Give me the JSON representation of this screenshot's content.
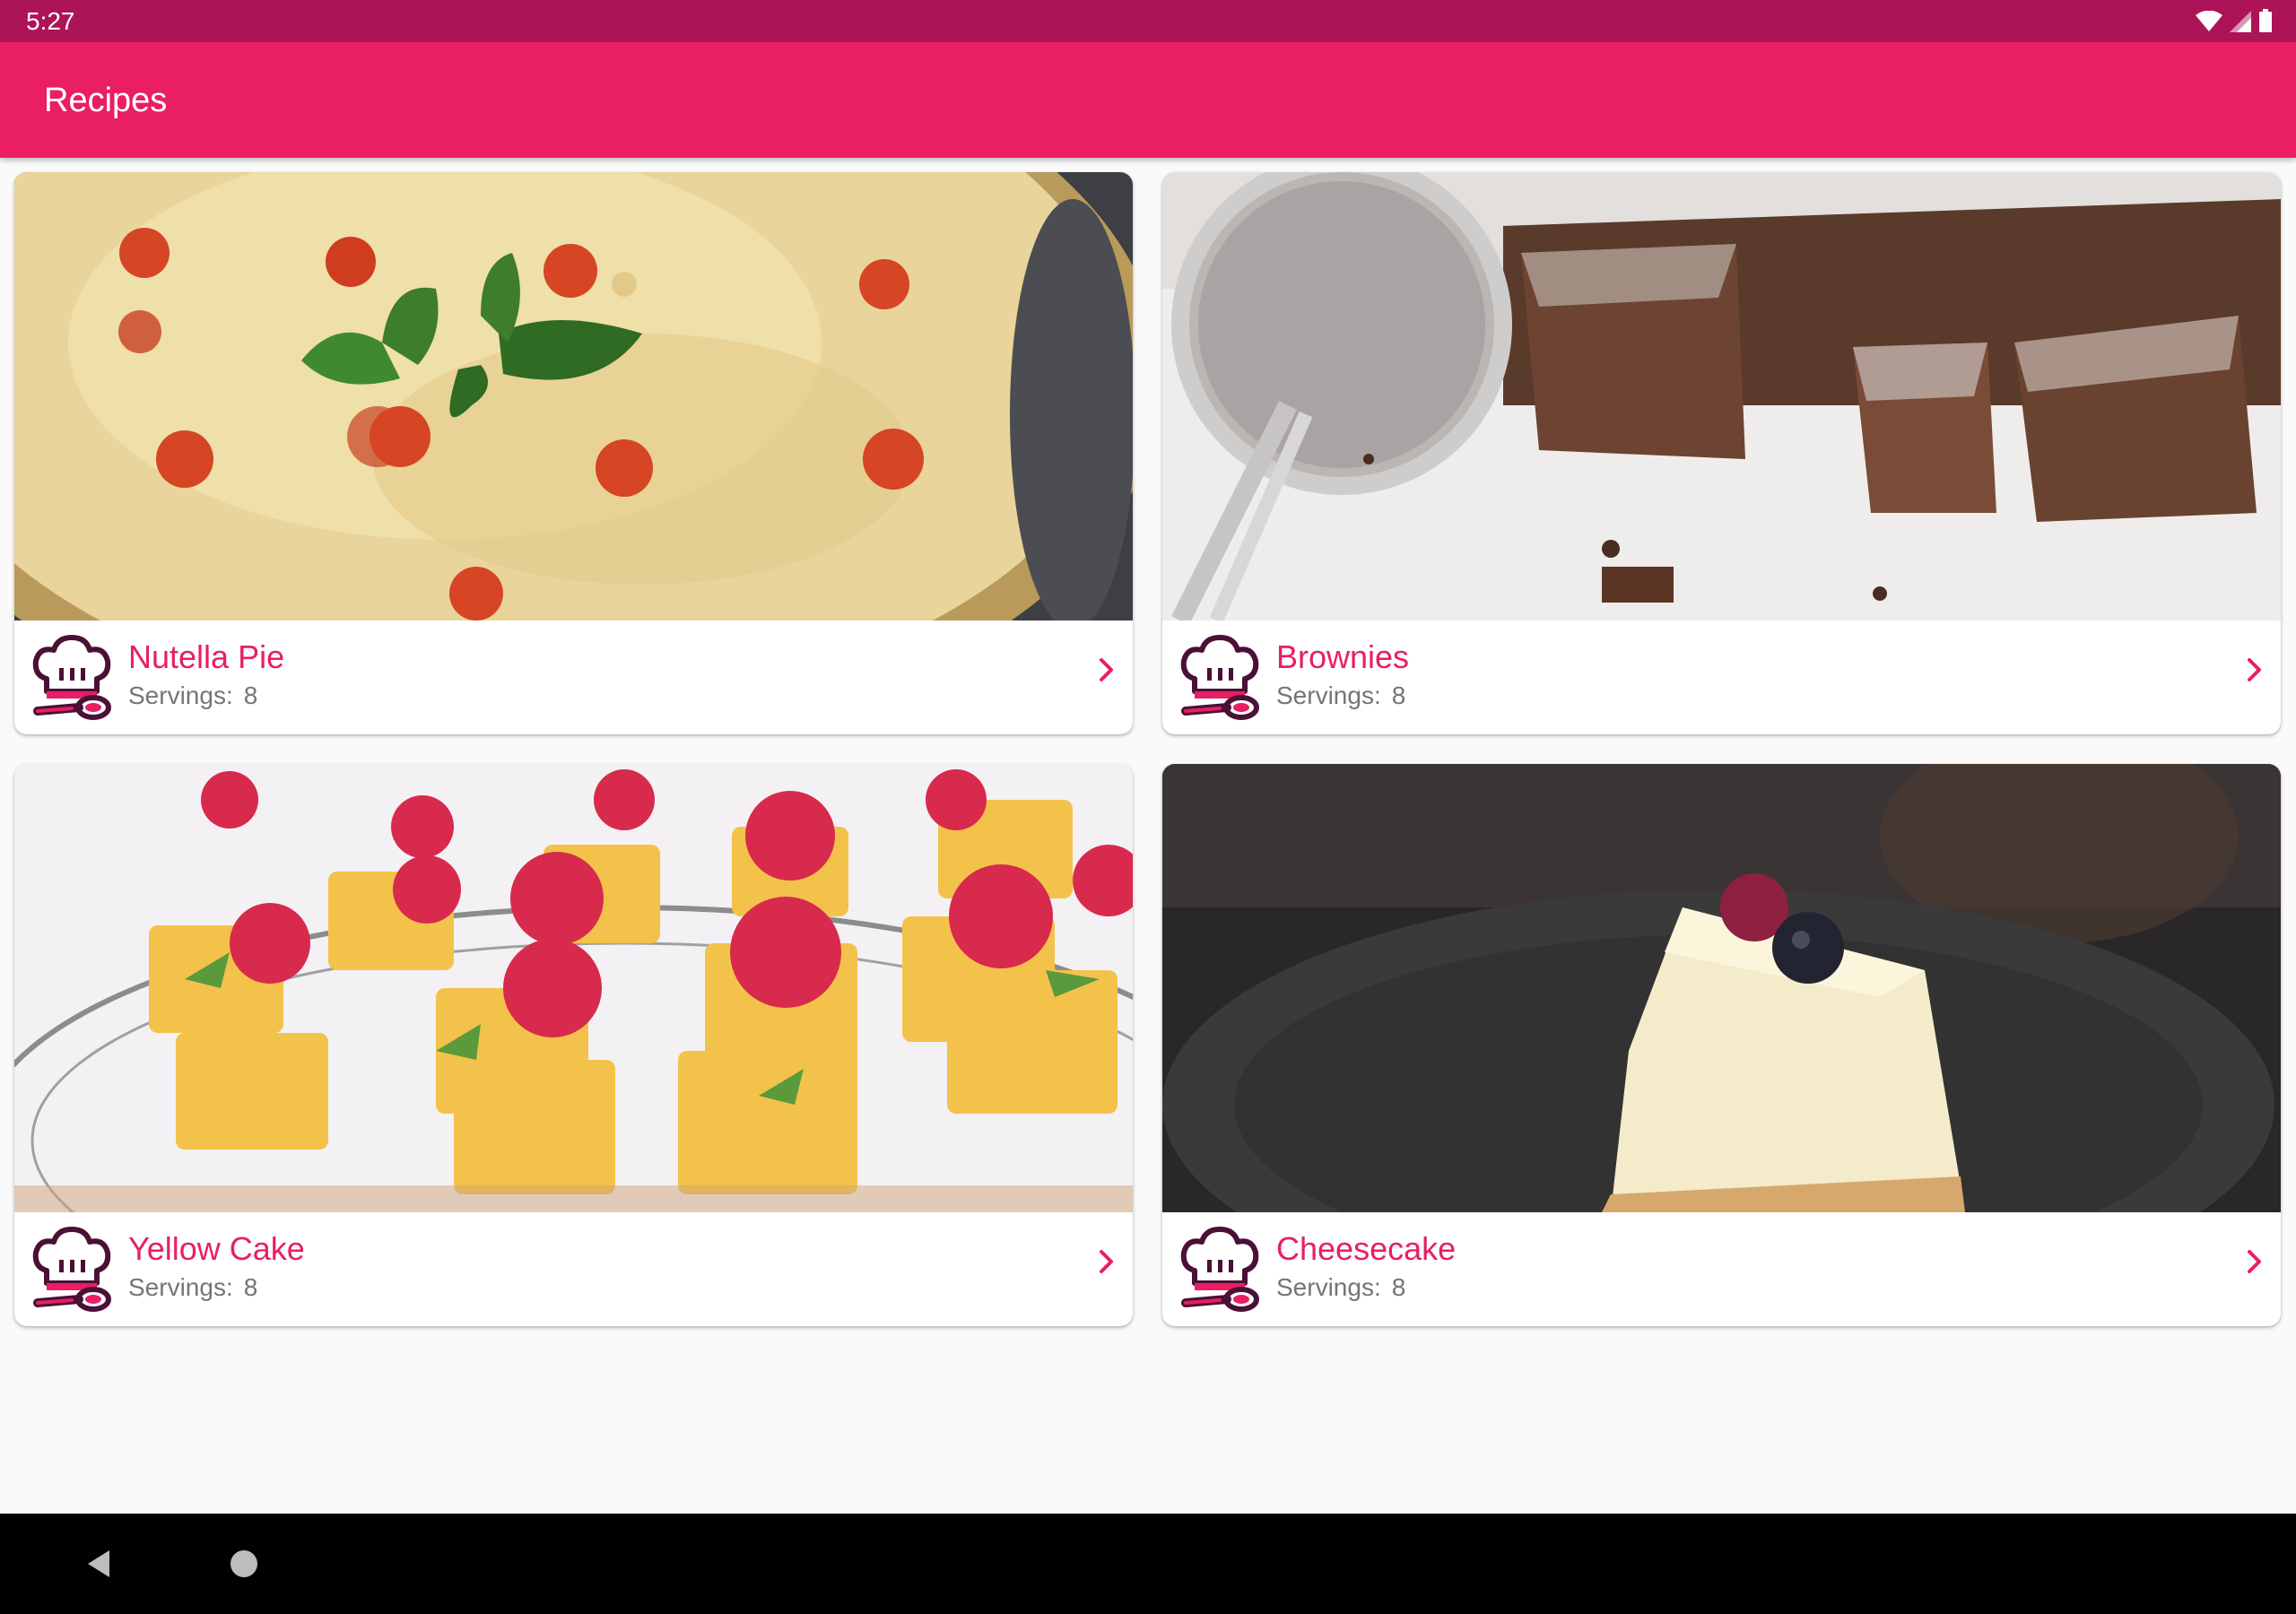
{
  "status_bar": {
    "time": "5:27"
  },
  "app_bar": {
    "title": "Recipes"
  },
  "colors": {
    "primary": "#e91e63",
    "primary_dark": "#ad1457",
    "chef_icon": "#4a1036"
  },
  "recipes": [
    {
      "name": "Nutella Pie",
      "servings_label": "Servings:",
      "servings": "8",
      "icon": "chef-hat-spoon-icon"
    },
    {
      "name": "Brownies",
      "servings_label": "Servings:",
      "servings": "8",
      "icon": "chef-hat-spoon-icon"
    },
    {
      "name": "Yellow Cake",
      "servings_label": "Servings:",
      "servings": "8",
      "icon": "chef-hat-spoon-icon"
    },
    {
      "name": "Cheesecake",
      "servings_label": "Servings:",
      "servings": "8",
      "icon": "chef-hat-spoon-icon"
    }
  ],
  "nav_bar": {
    "icons": [
      "back-icon",
      "home-icon"
    ]
  }
}
